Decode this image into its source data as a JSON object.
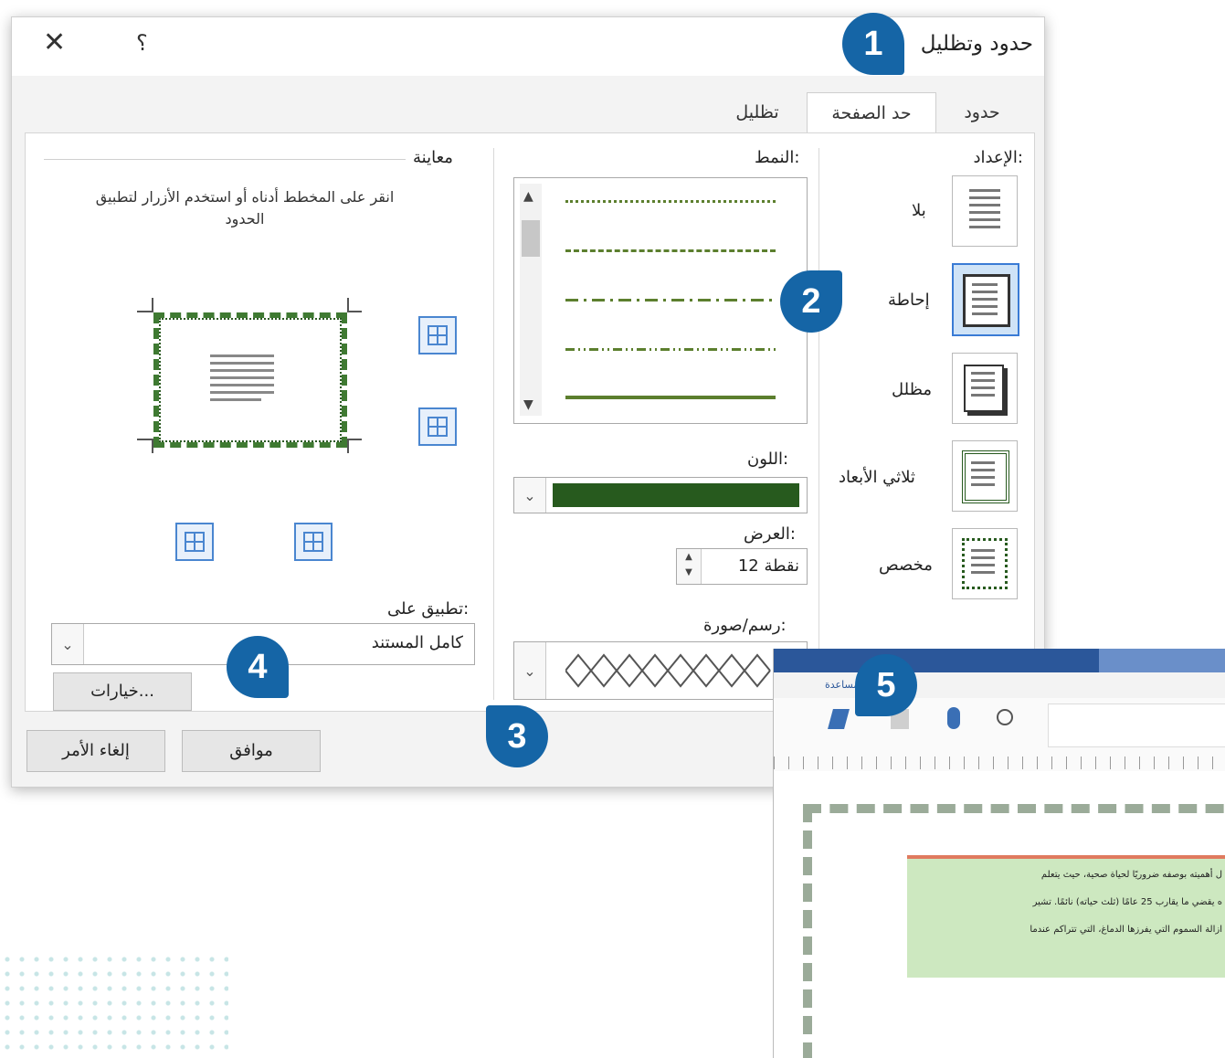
{
  "dialog": {
    "title": "حدود وتظليل",
    "help_label": "؟",
    "close_label": "✕",
    "tabs": [
      "حدود",
      "حد الصفحة",
      "تظليل"
    ],
    "active_tab": "حد الصفحة",
    "setting": {
      "label": "الإعداد:",
      "options": [
        "بلا",
        "إحاطة",
        "مظلل",
        "ثلاثي الأبعاد",
        "مخصص"
      ],
      "selected": "إحاطة"
    },
    "style": {
      "label": "النمط:"
    },
    "color": {
      "label": "اللون:",
      "value": "#275a1e"
    },
    "width": {
      "label": "العرض:",
      "value": "12 نقطة"
    },
    "art": {
      "label": "رسم/صورة:"
    },
    "preview": {
      "label": "معاينة",
      "instructions": "انقر على المخطط أدناه أو استخدم الأزرار لتطبيق الحدود"
    },
    "apply_to": {
      "label": "تطبيق على:",
      "value": "كامل المستند"
    },
    "options_button": "خيارات...",
    "ok_button": "موافق",
    "cancel_button": "إلغاء الأمر"
  },
  "callouts": [
    "1",
    "2",
    "3",
    "4",
    "5"
  ],
  "word_window": {
    "ribbon_tab": "مساعدة",
    "text_lines": [
      "ل أهميته بوصفه ضروريًا لحياة صحية، حيث يتعلم",
      "ه يقضي ما يقارب 25 عامًا (ثلث حياته) نائمًا. تشير",
      "ازالة السموم التي يفرزها الدماغ، التي تتراكم عندما"
    ]
  },
  "colors": {
    "accent": "#1565a6",
    "border_green": "#275a1e",
    "selection_blue": "#3a7bd5"
  }
}
